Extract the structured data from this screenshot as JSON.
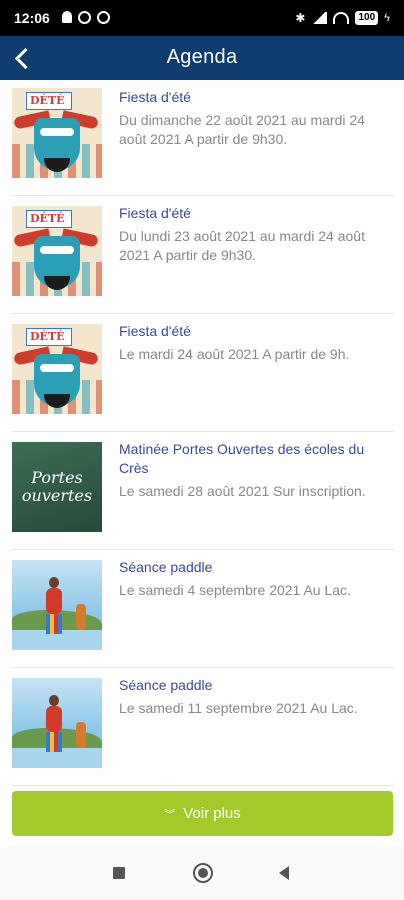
{
  "status_bar": {
    "time": "12:06",
    "battery": "100"
  },
  "app_bar": {
    "title": "Agenda"
  },
  "events": [
    {
      "title": "Fiesta d'été",
      "description": "Du dimanche 22 août 2021 au mardi 24 août 2021 A partir de 9h30.",
      "image": "fiesta-poster"
    },
    {
      "title": "Fiesta d'été",
      "description": "Du lundi 23 août 2021 au mardi 24 août 2021 A partir de 9h30.",
      "image": "fiesta-poster"
    },
    {
      "title": "Fiesta d'été",
      "description": "Le mardi 24 août 2021 A partir de 9h.",
      "image": "fiesta-poster"
    },
    {
      "title": "Matinée Portes Ouvertes des écoles du Crès",
      "description": "Le samedi 28 août 2021 Sur inscription.",
      "image": "chalkboard",
      "image_text_1": "Portes",
      "image_text_2": "ouvertes"
    },
    {
      "title": "Séance paddle",
      "description": "Le samedi 4 septembre 2021 Au Lac.",
      "image": "paddle-photo"
    },
    {
      "title": "Séance paddle",
      "description": "Le samedi 11 septembre 2021 Au Lac.",
      "image": "paddle-photo"
    }
  ],
  "more_button": {
    "label": "Voir plus",
    "icon": "double-chevron-down-icon"
  },
  "colors": {
    "app_bar": "#0d3c6e",
    "title_text": "#3a4a9a",
    "button": "#a3c92a"
  }
}
